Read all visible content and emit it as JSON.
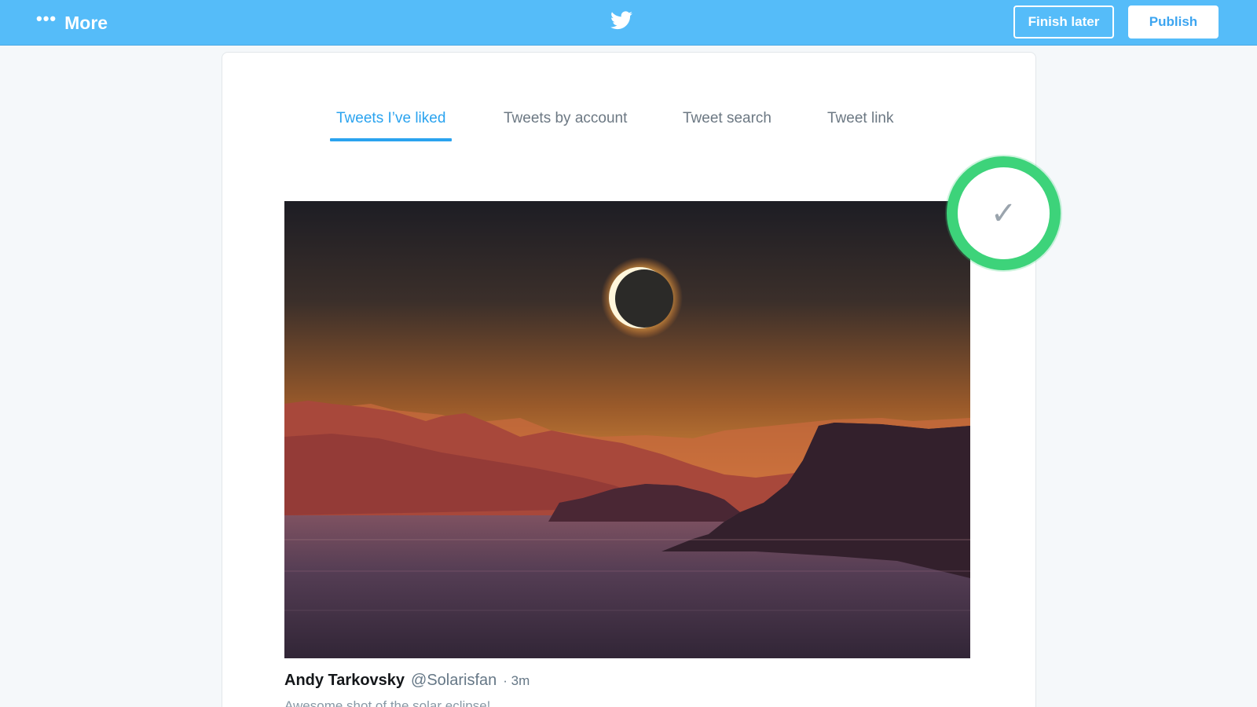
{
  "topbar": {
    "more_label": "More",
    "more_icon": "ellipsis-icon",
    "logo_icon": "twitter-bird-icon",
    "finish_later_label": "Finish later",
    "publish_label": "Publish",
    "brand_color": "#55bcf9"
  },
  "tabs": [
    {
      "label": "Tweets I’ve liked",
      "active": true
    },
    {
      "label": "Tweets by account",
      "active": false
    },
    {
      "label": "Tweet search",
      "active": false
    },
    {
      "label": "Tweet link",
      "active": false
    }
  ],
  "tweet": {
    "image_description_icon": "eclipse-photo",
    "selected": true,
    "select_icon": "checkmark-icon",
    "author_name": "Andy Tarkovsky",
    "author_handle": "@Solarisfan",
    "time": "· 3m",
    "text": "Awesome shot of the solar eclipse!"
  },
  "colors": {
    "accent": "#2aa3ef",
    "selection_ring": "#3dd37a"
  }
}
